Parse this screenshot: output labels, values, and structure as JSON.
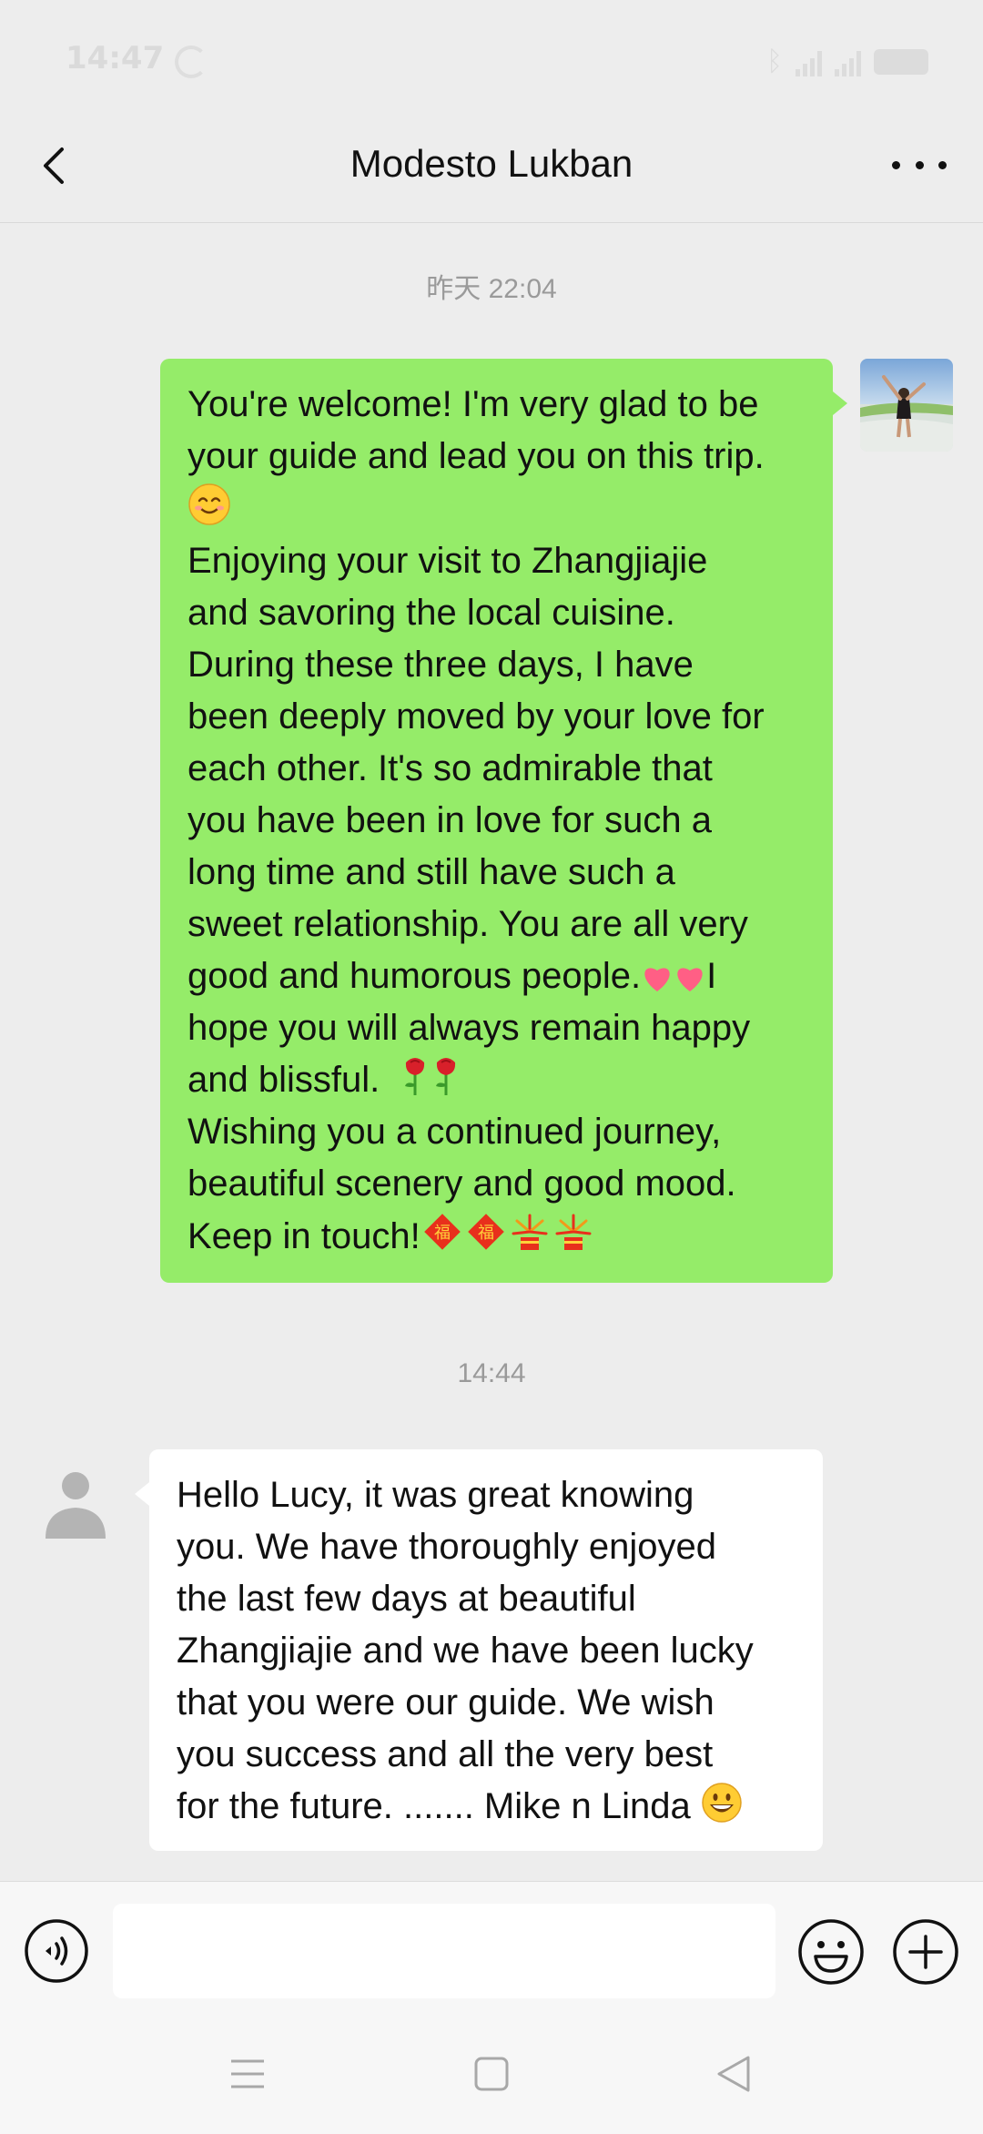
{
  "status_bar": {
    "time": "14:47"
  },
  "header": {
    "title": "Modesto Lukban",
    "back_icon": "chevron-left-icon",
    "more_icon": "more-dots-icon"
  },
  "chat": {
    "timestamp_1": "昨天 22:04",
    "timestamp_2": "14:44",
    "sent_message": {
      "lines": [
        "You're welcome! I'm very glad to be",
        "your guide and lead you on this trip.",
        "",
        "Enjoying your visit to Zhangjiajie",
        "and savoring the local cuisine.",
        "During these three days, I have",
        "been deeply moved by your love for",
        "each other. It's so admirable that",
        "you have been in love for such a",
        "long time and still have such a",
        "sweet relationship. You are all very",
        "good and humorous people.",
        "I",
        "hope you will always remain happy",
        "and blissful.",
        "Wishing you a continued journey,",
        "beautiful scenery and good mood.",
        "Keep in touch!"
      ],
      "bubble_color": "#95ec69"
    },
    "received_message": {
      "lines": [
        "Hello Lucy, it was great knowing",
        "you. We have thoroughly enjoyed",
        "the last few days at beautiful",
        "Zhangjiajie and we have been lucky",
        "that you were our guide. We wish",
        "you success and all the very best",
        "for the future.  ....... Mike n Linda"
      ],
      "bubble_color": "#ffffff"
    }
  },
  "input_bar": {
    "voice_icon": "voice-icon",
    "emoji_icon": "smiley-icon",
    "plus_icon": "plus-circle-icon",
    "input_value": ""
  },
  "nav_bar": {
    "menu_icon": "menu-icon",
    "home_icon": "home-square-icon",
    "back_icon": "back-triangle-icon"
  }
}
